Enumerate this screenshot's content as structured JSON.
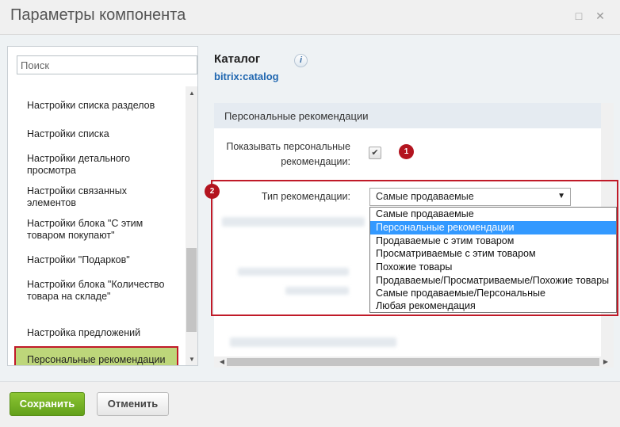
{
  "window": {
    "title": "Параметры компонента",
    "maximize_icon": "maximize-icon",
    "close_icon": "close-icon"
  },
  "sidebar": {
    "search_placeholder": "Поиск",
    "items": [
      {
        "label": "Настройки списка разделов"
      },
      {
        "label": "Настройки списка"
      },
      {
        "label": "Настройки детального просмотра"
      },
      {
        "label": "Настройки связанных элементов"
      },
      {
        "label": "Настройки блока \"С этим товаром покупают\""
      },
      {
        "label": "Настройки \"Подарков\""
      },
      {
        "label": "Настройки блока \"Количество товара на складе\""
      },
      {
        "label": "Настройка предложений"
      },
      {
        "label": "Персональные рекомендации"
      }
    ],
    "active_index": 8
  },
  "component": {
    "title": "Каталог",
    "code": "bitrix:catalog",
    "info_icon": "info-icon"
  },
  "section": {
    "title": "Персональные рекомендации",
    "show_label": "Показывать персональные рекомендации:",
    "show_checked": true,
    "type_label": "Тип рекомендации:",
    "type_value": "Самые продаваемые",
    "options": [
      "Самые продаваемые",
      "Персональные рекомендации",
      "Продаваемые с этим товаром",
      "Просматриваемые с этим товаром",
      "Похожие товары",
      "Продаваемые/Просматриваемые/Похожие товары",
      "Самые продаваемые/Персональные",
      "Любая рекомендация"
    ],
    "highlighted_option": 1
  },
  "badges": {
    "one": "1",
    "two": "2"
  },
  "footer": {
    "save_label": "Сохранить",
    "cancel_label": "Отменить"
  },
  "colors": {
    "accent_green": "#62a01a",
    "highlight_red": "#c01a28",
    "link_blue": "#2067b0",
    "active_item_bg": "#bdd67a",
    "selected_option_bg": "#3399ff"
  }
}
